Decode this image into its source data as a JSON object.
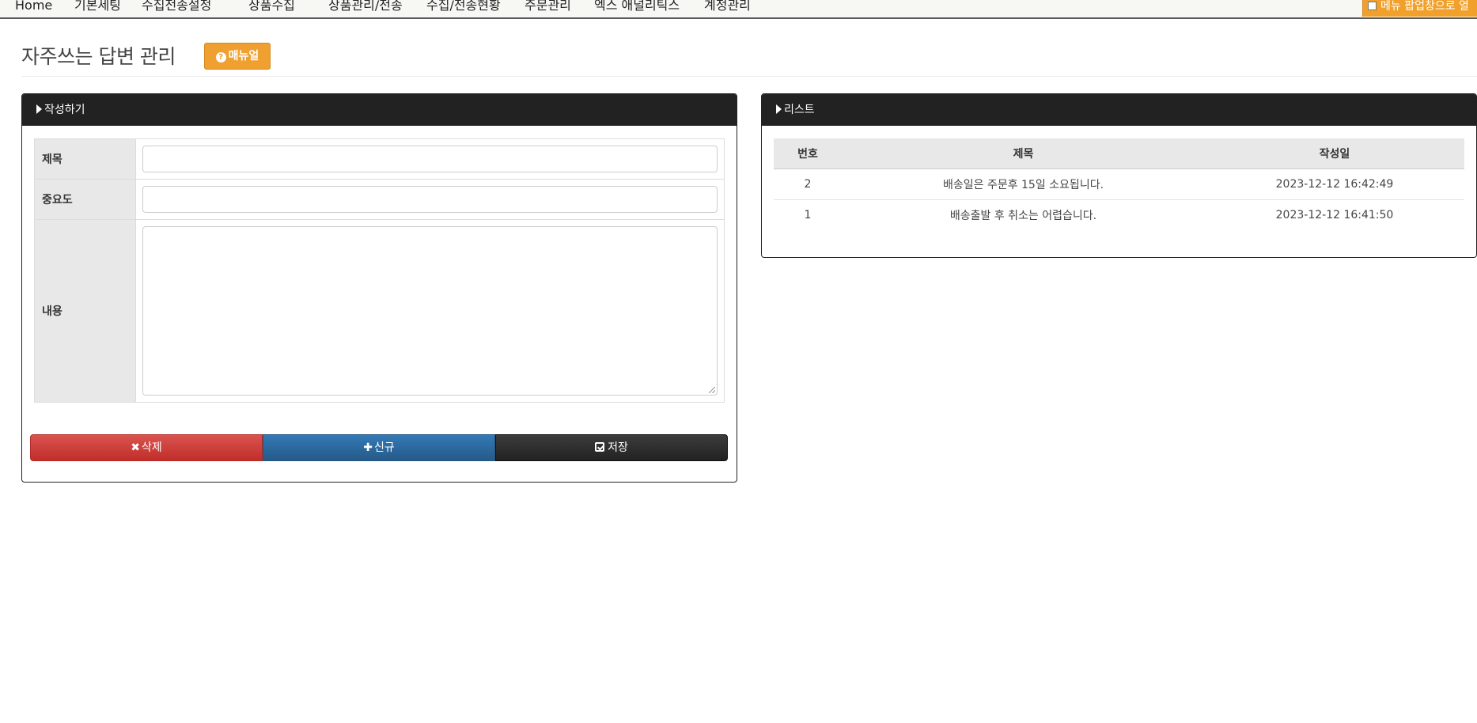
{
  "nav": {
    "items": [
      "Home",
      "기본세팅",
      "수집전송설정",
      "상품수집",
      "상품관리/전송",
      "수집/전송현황",
      "주문관리",
      "엑스 애널리틱스",
      "계정관리"
    ],
    "popup_toggle_label": "메뉴 팝업창으로 열"
  },
  "header": {
    "title": "자주쓰는 답변 관리",
    "manual_button_label": "매뉴얼"
  },
  "write_panel": {
    "title": "작성하기",
    "fields": {
      "subject_label": "제목",
      "importance_label": "중요도",
      "content_label": "내용"
    },
    "buttons": {
      "delete_label": "삭제",
      "new_label": "신규",
      "save_label": "저장"
    }
  },
  "list_panel": {
    "title": "리스트",
    "columns": [
      "번호",
      "제목",
      "작성일"
    ],
    "rows": [
      {
        "no": "2",
        "subject": "배송일은 주문후 15일 소요됩니다.",
        "date": "2023-12-12 16:42:49"
      },
      {
        "no": "1",
        "subject": "배송출발 후 취소는 어렵습니다.",
        "date": "2023-12-12 16:41:50"
      }
    ]
  }
}
